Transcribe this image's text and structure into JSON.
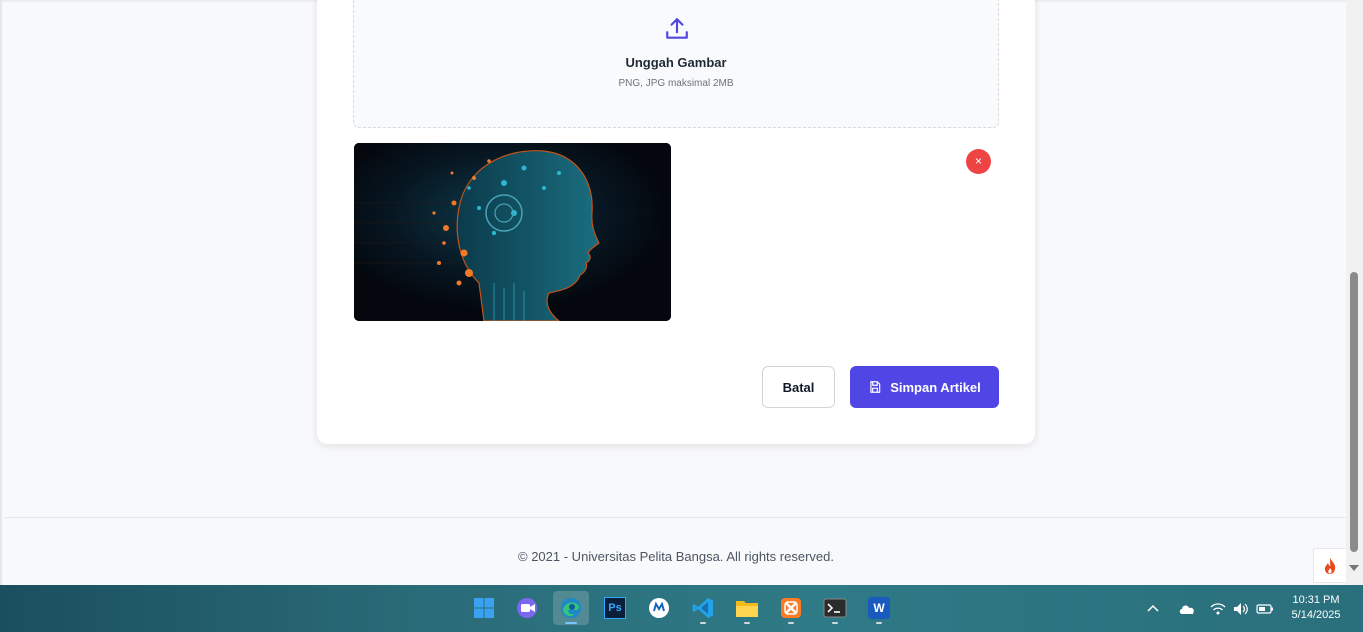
{
  "upload": {
    "title": "Unggah Gambar",
    "hint": "PNG, JPG maksimal 2MB",
    "icon": "upload-icon"
  },
  "preview": {
    "remove_label": "×",
    "remove_icon": "close-icon",
    "image_icon": "ai-head-image"
  },
  "actions": {
    "cancel_label": "Batal",
    "save_label": "Simpan Artikel",
    "save_icon": "save-icon"
  },
  "footer": {
    "text": "© 2021 - Universitas Pelita Bangsa. All rights reserved."
  },
  "colors": {
    "accent": "#4f46e5",
    "danger": "#ef4444"
  },
  "taskbar": {
    "apps": [
      "windows-start-icon",
      "meet-icon",
      "edge-icon",
      "photoshop-icon",
      "app-icon",
      "vscode-icon",
      "file-explorer-icon",
      "xampp-icon",
      "terminal-icon",
      "word-icon"
    ],
    "photoshop_label": "Ps",
    "word_label": "W",
    "clock_time": "10:31 PM",
    "clock_date": "5/14/2025"
  }
}
